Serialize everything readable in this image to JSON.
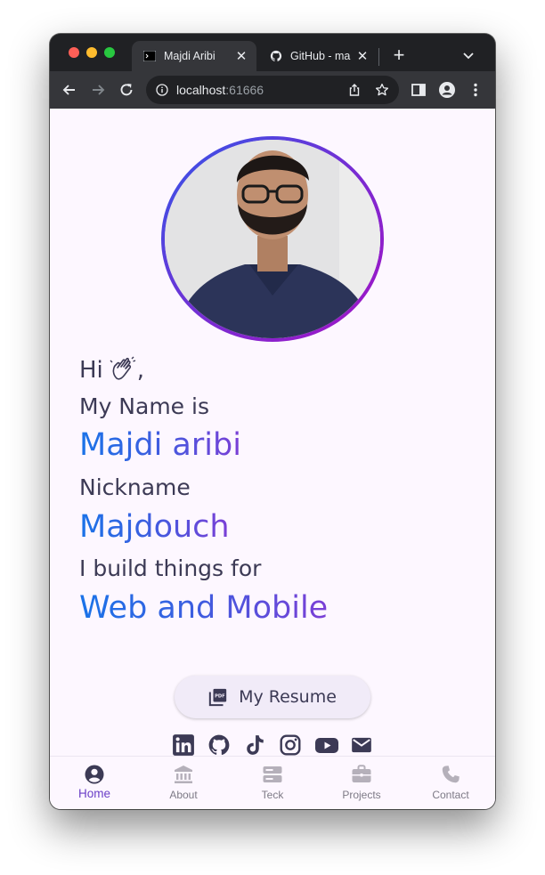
{
  "browser": {
    "tabs": [
      {
        "title": "Majdi Aribi",
        "active": true,
        "favicon": "terminal-icon"
      },
      {
        "title": "GitHub - ma",
        "active": false,
        "favicon": "github-icon"
      }
    ],
    "url_host": "localhost",
    "url_port": ":61666"
  },
  "hero": {
    "greeting": "Hi",
    "greeting_suffix": ",",
    "name_label": "My Name is",
    "name": "Majdi aribi",
    "nickname_label": "Nickname",
    "nickname": "Majdouch",
    "build_label": "I build things for",
    "build_value": "Web and Mobile"
  },
  "resume_button": {
    "label": "My Resume",
    "icon": "pdf-icon"
  },
  "socials": [
    "linkedin-icon",
    "github-icon",
    "tiktok-icon",
    "instagram-icon",
    "youtube-icon",
    "mail-icon"
  ],
  "bottom_nav": {
    "items": [
      {
        "label": "Home",
        "icon": "account-circle-icon",
        "active": true
      },
      {
        "label": "About",
        "icon": "bank-icon",
        "active": false
      },
      {
        "label": "Teck",
        "icon": "storage-icon",
        "active": false
      },
      {
        "label": "Projects",
        "icon": "briefcase-icon",
        "active": false
      },
      {
        "label": "Contact",
        "icon": "phone-icon",
        "active": false
      }
    ]
  },
  "colors": {
    "background": "#fdf7ff",
    "text": "#3c3a55",
    "accent": "#6a3fc7",
    "gradient_start": "#1a73e8",
    "gradient_end": "#7b3fd6",
    "ring_start": "#3356e8",
    "ring_end": "#a412c4"
  }
}
